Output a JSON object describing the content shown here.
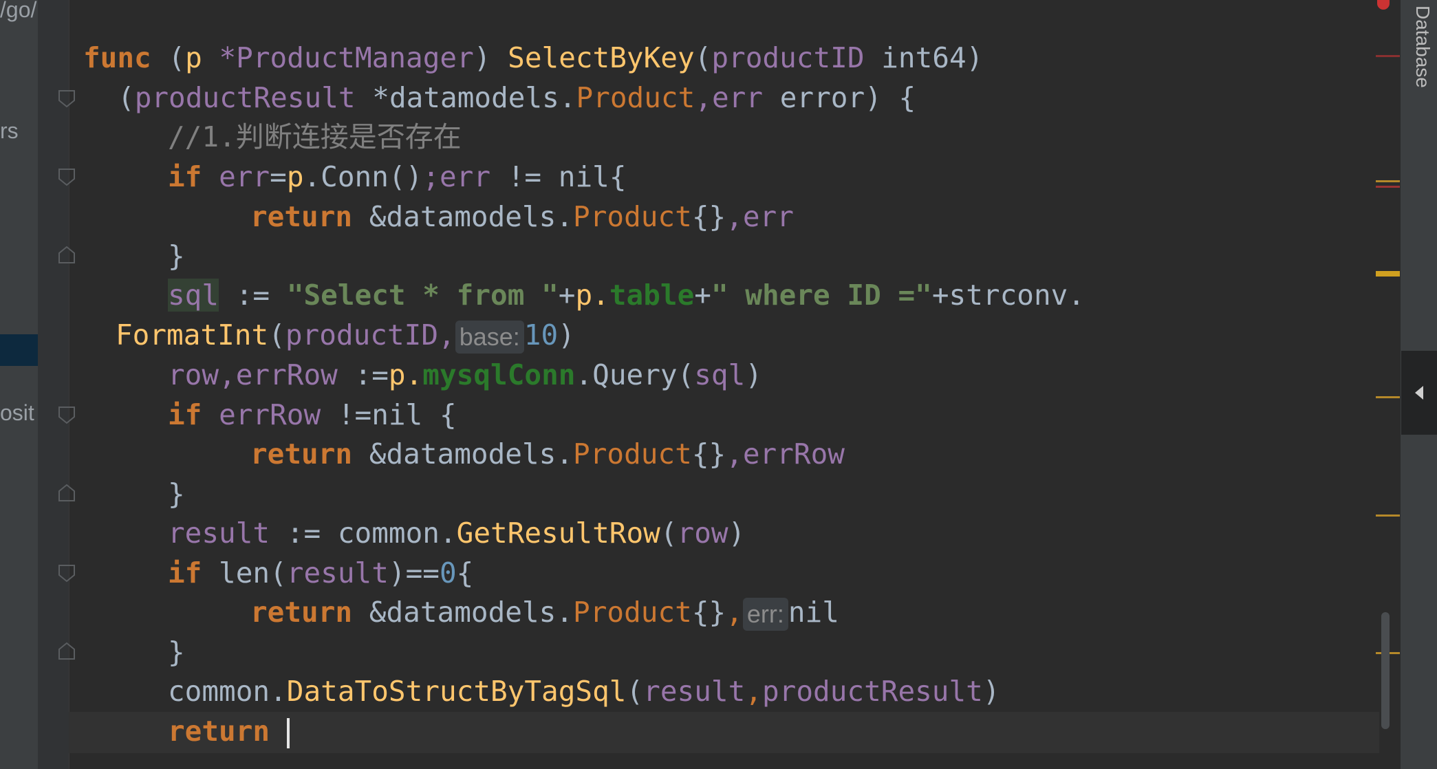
{
  "left_panel": {
    "fragments": [
      "/go/",
      "rs",
      "osit"
    ]
  },
  "right_bar": {
    "database_tab": "Database"
  },
  "colors": {
    "keyword": "#cc7832",
    "function": "#ffc66d",
    "identifier": "#9876aa",
    "string": "#6a8759",
    "comment": "#808080",
    "number": "#6897bb"
  },
  "code": {
    "l1": {
      "func": "func",
      "receiver_open": "(",
      "p": "p",
      "recv_type": "*ProductManager",
      "recv_close": ")",
      "name": "SelectByKey",
      "args_open": "(",
      "param": "productID",
      "param_type": "int64",
      "args_close": ")"
    },
    "l2": {
      "open": "(",
      "result": "productResult",
      "star_pkg": "*datamodels.",
      "result_type": "Product",
      "comma_err": ",err",
      "err_type": "error",
      "close": ") {"
    },
    "l3": {
      "comment": "//1.判断连接是否存在"
    },
    "l4": {
      "if": "if",
      "err": "err",
      "assign": "=",
      "p": "p",
      "conn": ".Conn()",
      "semi": ";err",
      "cmp": " != nil{"
    },
    "l5": {
      "return": "return",
      "amp": "&datamodels.",
      "type": "Product",
      "brace": "{}",
      "tail": ",err"
    },
    "l6": {
      "brace": "}"
    },
    "l7": {
      "sql": "sql",
      "assign": " := ",
      "str1": "\"Select * from \"",
      "plus1": "+",
      "p": "p.",
      "field": "table",
      "plus2": "+",
      "str2": "\" where ID =\"",
      "plus3": "+strconv."
    },
    "l8": {
      "fn": "FormatInt",
      "open": "(",
      "arg": "productID,",
      "hint": "base:",
      "num": "10",
      "close": ")"
    },
    "l9": {
      "row": "row,errRow",
      "assign": " :=",
      "p": "p.",
      "field": "mysqlConn",
      "query": ".Query",
      "open": "(",
      "arg": "sql",
      "close": ")"
    },
    "l10": {
      "if": "if",
      "var": "errRow",
      "cmp": " !=nil {"
    },
    "l11": {
      "return": "return",
      "amp": "&datamodels.",
      "type": "Product",
      "brace": "{}",
      "tail": ",errRow"
    },
    "l12": {
      "brace": "}"
    },
    "l13": {
      "var": "result",
      "assign": " := common.",
      "fn": "GetResultRow",
      "open": "(",
      "arg": "row",
      "close": ")"
    },
    "l14": {
      "if": "if",
      "len": " len(",
      "var": "result",
      "cmp": ")==",
      "num": "0",
      "brace": "{"
    },
    "l15": {
      "return": "return",
      "amp": "&datamodels.",
      "type": "Product",
      "brace": "{}",
      "comma": ",",
      "hint": "err:",
      "tail": "nil"
    },
    "l16": {
      "brace": "}"
    },
    "l17": {
      "pkg": "common.",
      "fn": "DataToStructByTagSql",
      "open": "(",
      "arg1": "result",
      "comma": ",",
      "arg2": "productResult",
      "close": ")"
    },
    "l18": {
      "return": "return"
    }
  }
}
